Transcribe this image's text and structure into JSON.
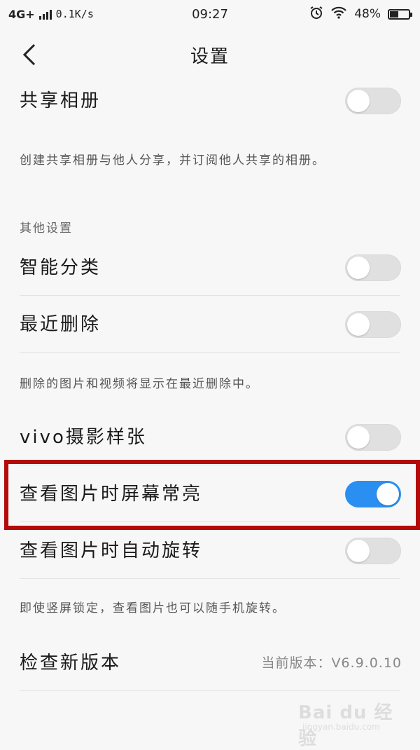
{
  "status_bar": {
    "network": "4G+",
    "speed": "0.1K/s",
    "time": "09:27",
    "battery": "48%",
    "battery_level": 0.48
  },
  "nav": {
    "title": "设置"
  },
  "settings": {
    "shared_album": {
      "label": "共享相册",
      "enabled": false,
      "description": "创建共享相册与他人分享，并订阅他人共享的相册。"
    },
    "section_other": "其他设置",
    "smart_classify": {
      "label": "智能分类",
      "enabled": false
    },
    "recently_deleted": {
      "label": "最近删除",
      "enabled": false,
      "description": "删除的图片和视频将显示在最近删除中。"
    },
    "vivo_samples": {
      "label": "vivo摄影样张",
      "enabled": false
    },
    "keep_screen_on": {
      "label": "查看图片时屏幕常亮",
      "enabled": true
    },
    "auto_rotate": {
      "label": "查看图片时自动旋转",
      "enabled": false,
      "description": "即使竖屏锁定，查看图片也可以随手机旋转。"
    },
    "check_update": {
      "label": "检查新版本",
      "version": "当前版本：V6.9.0.10"
    }
  },
  "watermark": {
    "brand": "Bai du 经验",
    "url": "jingyan.baidu.com"
  },
  "colors": {
    "toggle_on": "#2b8ff2",
    "toggle_off": "#e0e0e0",
    "highlight": "#b30a0a"
  }
}
